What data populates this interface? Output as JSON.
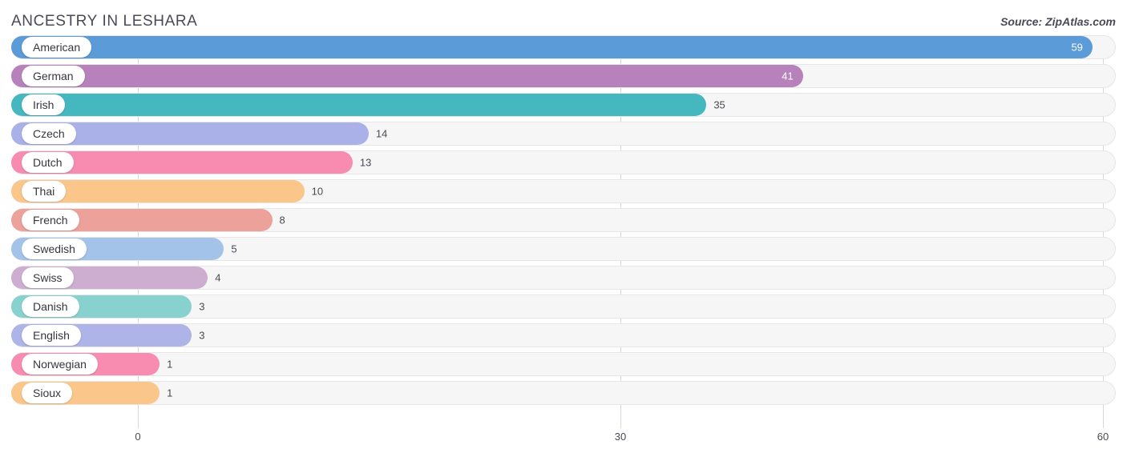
{
  "header": {
    "title": "ANCESTRY IN LESHARA",
    "source": "Source: ZipAtlas.com"
  },
  "chart_data": {
    "type": "bar",
    "orientation": "horizontal",
    "title": "ANCESTRY IN LESHARA",
    "subtitle": "",
    "xlabel": "",
    "ylabel": "",
    "xlim": [
      0,
      60
    ],
    "xticks": [
      0,
      30,
      60
    ],
    "xtick_labels": [
      "0",
      "30",
      "60"
    ],
    "grid": true,
    "legend": false,
    "categories": [
      "American",
      "German",
      "Irish",
      "Czech",
      "Dutch",
      "Thai",
      "French",
      "Swedish",
      "Swiss",
      "Danish",
      "English",
      "Norwegian",
      "Sioux"
    ],
    "values": [
      59,
      41,
      35,
      14,
      13,
      10,
      8,
      5,
      4,
      3,
      3,
      1,
      1
    ],
    "colors": [
      "#5b9bd8",
      "#b782bb",
      "#45b8bf",
      "#aab0e8",
      "#f78cb0",
      "#fbc68a",
      "#eca19a",
      "#a3c4e8",
      "#cdaed0",
      "#87d2cf",
      "#aeb4e8",
      "#f78cb0",
      "#fbc68a"
    ],
    "value_inside": [
      true,
      true,
      false,
      false,
      false,
      false,
      false,
      false,
      false,
      false,
      false,
      false,
      false
    ],
    "bars": [
      {
        "label": "American",
        "value": 59,
        "value_text": "59",
        "color": "#5b9bd8",
        "inside": true
      },
      {
        "label": "German",
        "value": 41,
        "value_text": "41",
        "color": "#b782bb",
        "inside": true
      },
      {
        "label": "Irish",
        "value": 35,
        "value_text": "35",
        "color": "#45b8bf",
        "inside": false
      },
      {
        "label": "Czech",
        "value": 14,
        "value_text": "14",
        "color": "#aab0e8",
        "inside": false
      },
      {
        "label": "Dutch",
        "value": 13,
        "value_text": "13",
        "color": "#f78cb0",
        "inside": false
      },
      {
        "label": "Thai",
        "value": 10,
        "value_text": "10",
        "color": "#fbc68a",
        "inside": false
      },
      {
        "label": "French",
        "value": 8,
        "value_text": "8",
        "color": "#eca19a",
        "inside": false
      },
      {
        "label": "Swedish",
        "value": 5,
        "value_text": "5",
        "color": "#a3c4e8",
        "inside": false
      },
      {
        "label": "Swiss",
        "value": 4,
        "value_text": "4",
        "color": "#cdaed0",
        "inside": false
      },
      {
        "label": "Danish",
        "value": 3,
        "value_text": "3",
        "color": "#87d2cf",
        "inside": false
      },
      {
        "label": "English",
        "value": 3,
        "value_text": "3",
        "color": "#aeb4e8",
        "inside": false
      },
      {
        "label": "Norwegian",
        "value": 1,
        "value_text": "1",
        "color": "#f78cb0",
        "inside": false
      },
      {
        "label": "Sioux",
        "value": 1,
        "value_text": "1",
        "color": "#fbc68a",
        "inside": false
      }
    ]
  }
}
